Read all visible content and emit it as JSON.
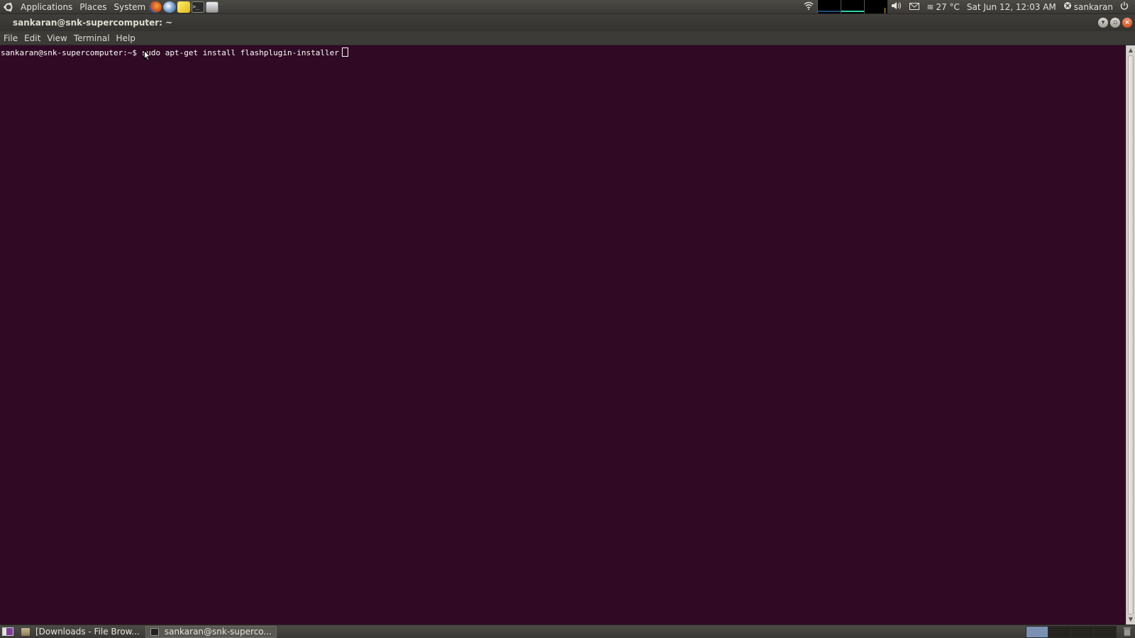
{
  "top_panel": {
    "menus": [
      "Applications",
      "Places",
      "System"
    ],
    "launchers": [
      "firefox-icon",
      "web-browser-icon",
      "notes-icon",
      "terminal-icon",
      "screenshot-icon"
    ],
    "temperature": "27 °C",
    "datetime": "Sat Jun 12, 12:03 AM",
    "user": "sankaran"
  },
  "window": {
    "title": "sankaran@snk-supercomputer: ~",
    "menus": [
      "File",
      "Edit",
      "View",
      "Terminal",
      "Help"
    ]
  },
  "terminal": {
    "prompt": "sankaran@snk-supercomputer:~$ ",
    "command": "sudo apt-get install flashplugin-installer",
    "background": "#300a24",
    "foreground": "#ffffff"
  },
  "bottom_panel": {
    "tasks": [
      {
        "label": "[Downloads - File Brow...",
        "active": false
      },
      {
        "label": "sankaran@snk-superco...",
        "active": true
      }
    ]
  }
}
